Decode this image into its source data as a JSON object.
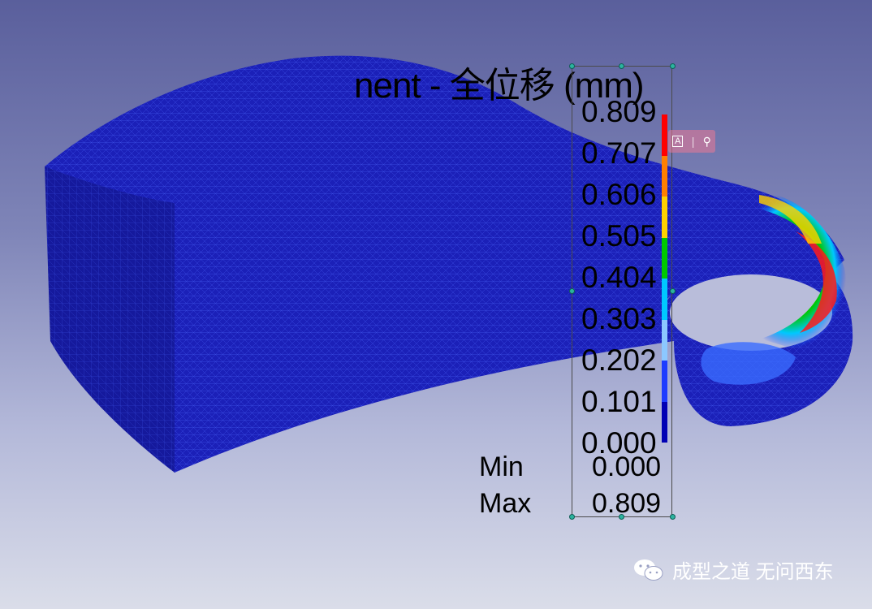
{
  "legend": {
    "title": "nent - 全位移 (mm)",
    "values": [
      "0.809",
      "0.707",
      "0.606",
      "0.505",
      "0.404",
      "0.303",
      "0.202",
      "0.101",
      "0.000"
    ],
    "colors": [
      "#ff0000",
      "#ff7f00",
      "#ffd200",
      "#00c800",
      "#00c8ff",
      "#8cc8ff",
      "#1e3cff",
      "#0000b4"
    ],
    "min_label": "Min",
    "min_value": "0.000",
    "max_label": "Max",
    "max_value": "0.809"
  },
  "popup": {
    "icon1": "text-scan-icon",
    "icon2": "search-icon",
    "glyph1": "A",
    "glyph2": "⚲"
  },
  "watermark": {
    "text": "成型之道 无问西东",
    "icon": "wechat-icon"
  },
  "colors": {
    "mesh_blue": "#1a1fb3",
    "bg_top": "#5a5f9c",
    "bg_bottom": "#dadde9"
  }
}
